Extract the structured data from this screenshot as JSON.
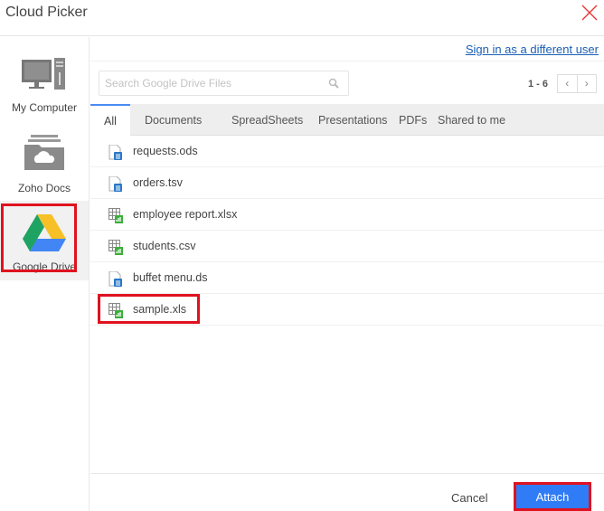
{
  "window": {
    "title": "Cloud Picker"
  },
  "sidebar": {
    "items": [
      {
        "label": "My Computer"
      },
      {
        "label": "Zoho Docs"
      },
      {
        "label": "Google Drive",
        "active": true
      }
    ]
  },
  "header": {
    "signin_link": "Sign in as a different user"
  },
  "search": {
    "placeholder": "Search Google Drive Files",
    "value": ""
  },
  "pager": {
    "range": "1 - 6",
    "prev": "‹",
    "next": "›"
  },
  "tabs": [
    {
      "label": "All",
      "active": true
    },
    {
      "label": "Documents"
    },
    {
      "label": "SpreadSheets"
    },
    {
      "label": "Presentations"
    },
    {
      "label": "PDFs"
    },
    {
      "label": "Shared to me"
    }
  ],
  "files": [
    {
      "name": "requests.ods",
      "type": "document"
    },
    {
      "name": "orders.tsv",
      "type": "document"
    },
    {
      "name": "employee report.xlsx",
      "type": "spreadsheet"
    },
    {
      "name": "students.csv",
      "type": "spreadsheet"
    },
    {
      "name": "buffet menu.ds",
      "type": "document"
    },
    {
      "name": "sample.xls",
      "type": "spreadsheet",
      "highlighted": true
    }
  ],
  "footer": {
    "cancel": "Cancel",
    "attach": "Attach"
  },
  "colors": {
    "accent": "#2f7cf6",
    "highlight": "#e0121f",
    "tab_active": "#4a8af4",
    "link": "#1a5fb4"
  }
}
